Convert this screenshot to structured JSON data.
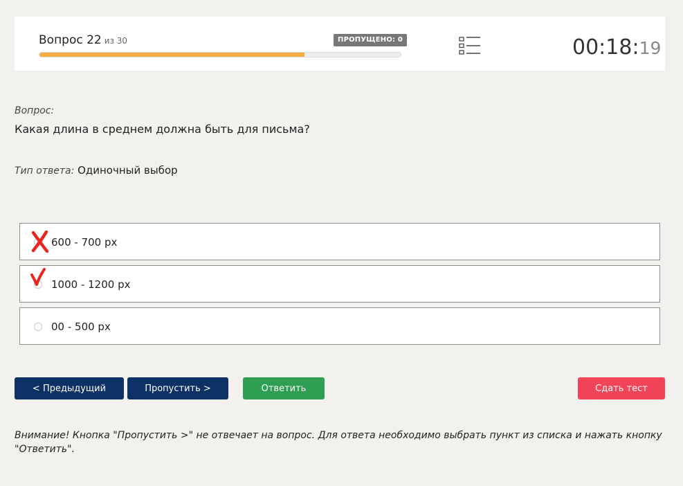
{
  "header": {
    "question_label": "Вопрос 22",
    "question_of": "из 30",
    "progress": 0.7333,
    "skipped_badge": "ПРОПУЩЕНО: 0",
    "timer_main": "00:18:",
    "timer_seconds": "19",
    "progress_color": "#f4ad42",
    "list_icon": "list-icon"
  },
  "question": {
    "label": "Вопрос:",
    "text": "Какая длина в среднем должна быть для письма?"
  },
  "answer_type": {
    "label": "Тип ответа:",
    "value": "Одиночный выбор"
  },
  "options": [
    {
      "text": "600 - 700 px",
      "mark": "wrong-cross-icon"
    },
    {
      "text": "1000 - 1200 px",
      "mark": "correct-check-icon"
    },
    {
      "text": "00 - 500 px",
      "mark": ""
    }
  ],
  "buttons": {
    "prev": "< Предыдущий",
    "skip": "Пропустить >",
    "answer": "Ответить",
    "finish": "Сдать тест"
  },
  "colors": {
    "prev": "#0d3164",
    "skip": "#0d3164",
    "answer": "#2d9e52",
    "finish": "#f24459",
    "mark": "#e8261f"
  },
  "warning": "Внимание! Кнопка \"Пропустить >\" не отвечает на вопрос. Для ответа необходимо выбрать пункт из списка и нажать кнопку \"Ответить\"."
}
